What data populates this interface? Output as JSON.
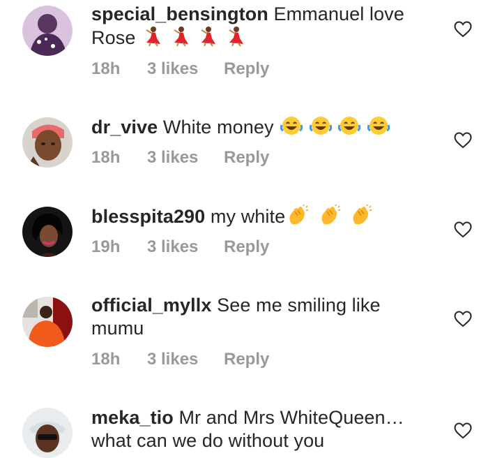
{
  "comments": [
    {
      "username": "special_bensington",
      "text_line1": "Emmanuel love",
      "text_line2": "Rose",
      "emojis": "dancer-emoji x4",
      "time": "18h",
      "likes": "3 likes",
      "reply": "Reply"
    },
    {
      "username": "dr_vive",
      "text_line1": "White money",
      "emojis": "laughing-tears-emoji x4",
      "time": "18h",
      "likes": "3 likes",
      "reply": "Reply"
    },
    {
      "username": "blesspita290",
      "text_line1": "my white",
      "emojis": "clapping-hands-emoji x3",
      "time": "19h",
      "likes": "3 likes",
      "reply": "Reply"
    },
    {
      "username": "official_myllx",
      "text_line1": "See me smiling like",
      "text_line2": "mumu",
      "time": "18h",
      "likes": "3 likes",
      "reply": "Reply"
    },
    {
      "username": "meka_tio",
      "text_line1": "Mr and Mrs WhiteQueen…",
      "text_line2": "what can we do without you"
    }
  ],
  "icons": {
    "like": "heart-outline-icon"
  },
  "colors": {
    "text": "#262626",
    "meta": "#999999",
    "heart_stroke": "#262626"
  }
}
